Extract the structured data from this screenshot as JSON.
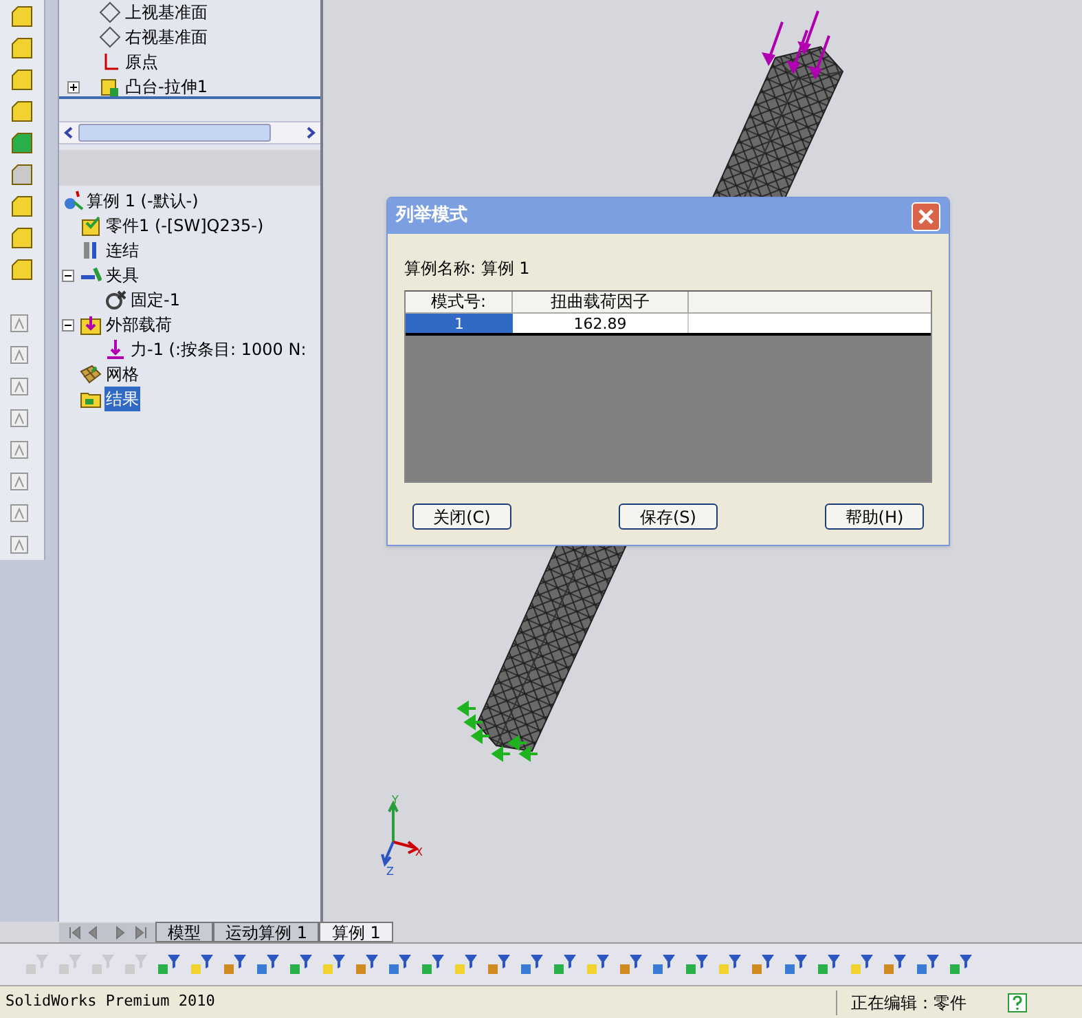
{
  "feature_tree": [
    {
      "label": "上视基准面",
      "kind": "plane"
    },
    {
      "label": "右视基准面",
      "kind": "plane"
    },
    {
      "label": "原点",
      "kind": "origin"
    },
    {
      "label": "凸台-拉伸1",
      "kind": "feature",
      "expanded": false
    }
  ],
  "study_tree": {
    "label": "算例 1 (-默认-)",
    "selected": false,
    "children": [
      {
        "label": "零件1 (-[SW]Q235-)",
        "kind": "part",
        "selected": false
      },
      {
        "label": "连结",
        "kind": "connection",
        "selected": false
      },
      {
        "label": "夹具",
        "kind": "fixture",
        "selected": false,
        "expanded": true,
        "children": [
          {
            "label": "固定-1",
            "kind": "fixed",
            "selected": false
          }
        ]
      },
      {
        "label": "外部载荷",
        "kind": "loads",
        "selected": false,
        "expanded": true,
        "children": [
          {
            "label": "力-1 (:按条目: 1000 N:",
            "kind": "force",
            "selected": false
          }
        ]
      },
      {
        "label": "网格",
        "kind": "mesh",
        "selected": false
      },
      {
        "label": "结果",
        "kind": "results",
        "selected": true
      }
    ]
  },
  "bottom_tabs": [
    {
      "label": "模型",
      "selected": false
    },
    {
      "label": "运动算例 1",
      "selected": false
    },
    {
      "label": "算例 1",
      "selected": true
    }
  ],
  "triad": {
    "x": "X",
    "y": "Y",
    "z": "Z"
  },
  "dialog": {
    "title": "列举模式",
    "study_name": "算例名称: 算例 1",
    "columns": [
      "模式号:",
      "扭曲载荷因子"
    ],
    "rows": [
      {
        "cells": [
          "1",
          "162.89"
        ],
        "selected": true
      }
    ],
    "buttons": [
      "关闭(C)",
      "保存(S)",
      "帮助(H)"
    ]
  },
  "status_bar": {
    "app": "SolidWorks Premium 2010",
    "mode": "正在编辑：零件"
  }
}
